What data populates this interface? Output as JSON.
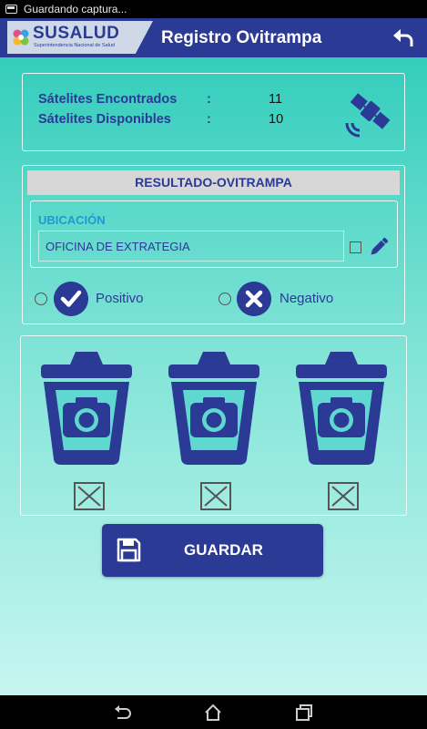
{
  "status_bar": {
    "notification": "Guardando captura..."
  },
  "app_bar": {
    "brand": "SUSALUD",
    "brand_subtitle": "Superintendencia Nacional de Salud",
    "title": "Registro Ovitrampa",
    "back_icon": "back-arrow-icon"
  },
  "satellites": {
    "found_label": "Sátelites Encontrados",
    "found_value": "11",
    "available_label": "Sátelites Disponibles",
    "available_value": "10",
    "separator": ":",
    "icon": "satellite-icon"
  },
  "result": {
    "header": "RESULTADO-OVITRAMPA",
    "location_label": "UBICACIÓN",
    "location_value": "OFICINA DE EXTRATEGIA",
    "positive_label": "Positivo",
    "negative_label": "Negativo"
  },
  "photos": {
    "slots": [
      {
        "icon": "camera-bucket-icon",
        "checked": false
      },
      {
        "icon": "camera-bucket-icon",
        "checked": false
      },
      {
        "icon": "camera-bucket-icon",
        "checked": false
      }
    ]
  },
  "save_button": {
    "label": "GUARDAR",
    "icon": "floppy-disk-icon"
  },
  "colors": {
    "primary": "#2b3a95",
    "accent_blue": "#2196d9",
    "background_top": "#33cdbc",
    "background_bottom": "#c6f6f0",
    "header_gray": "#d7d7d7"
  }
}
